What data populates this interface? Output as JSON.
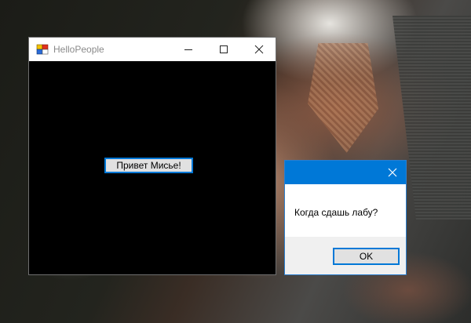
{
  "main_window": {
    "title": "HelloPeople",
    "icon": "app-icon",
    "controls": [
      "minimize-icon",
      "maximize-icon",
      "close-icon"
    ],
    "button_label": "Привет Мисье!"
  },
  "message_box": {
    "title": "",
    "text": "Когда сдашь лабу?",
    "ok_label": "OK"
  },
  "colors": {
    "accent": "#0078d7",
    "client_background": "#000000",
    "button_face": "#e1e1e1"
  }
}
